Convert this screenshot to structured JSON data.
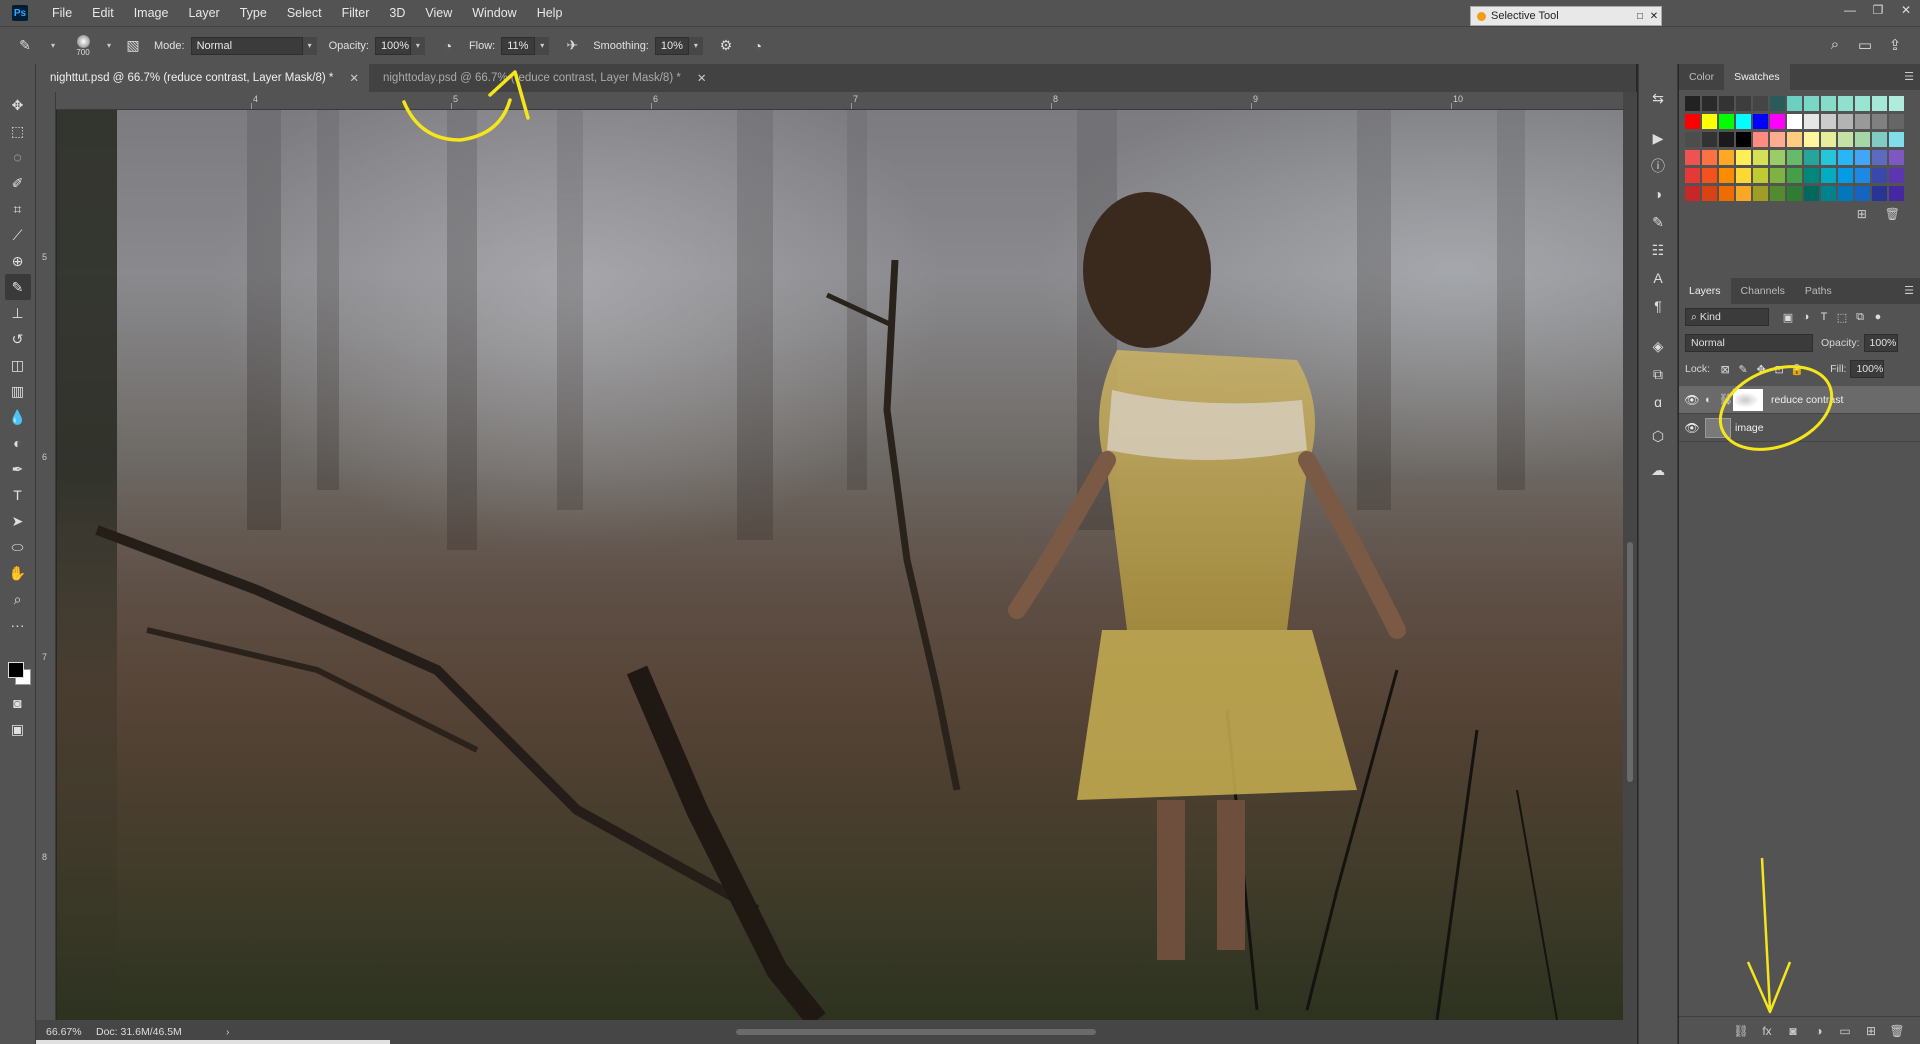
{
  "app": {
    "logo": "Ps"
  },
  "menu": [
    "File",
    "Edit",
    "Image",
    "Layer",
    "Type",
    "Select",
    "Filter",
    "3D",
    "View",
    "Window",
    "Help"
  ],
  "popup": {
    "title": "Selective Tool"
  },
  "options": {
    "brush_size": "700",
    "mode_label": "Mode:",
    "mode_value": "Normal",
    "opacity_label": "Opacity:",
    "opacity_value": "100%",
    "flow_label": "Flow:",
    "flow_value": "11%",
    "smoothing_label": "Smoothing:",
    "smoothing_value": "10%"
  },
  "tabs": [
    {
      "label": "nighttut.psd @ 66.7% (reduce contrast, Layer Mask/8) *",
      "active": true
    },
    {
      "label": "nighttoday.psd @ 66.7% (reduce contrast, Layer Mask/8) *",
      "active": false
    }
  ],
  "ruler": {
    "top": [
      "4",
      "5",
      "6",
      "7",
      "8",
      "9",
      "10"
    ],
    "left": [
      "5",
      "6",
      "7",
      "8"
    ]
  },
  "status": {
    "zoom": "66.67%",
    "doc": "Doc: 31.6M/46.5M",
    "arrow": "›"
  },
  "panels": {
    "top_tabs": [
      "Color",
      "Swatches"
    ],
    "active_top_tab": "Swatches",
    "layer_tabs": [
      "Layers",
      "Channels",
      "Paths"
    ],
    "active_layer_tab": "Layers",
    "kind_label": "Kind",
    "blend_mode": "Normal",
    "opacity_label": "Opacity:",
    "opacity_value": "100%",
    "lock_label": "Lock:",
    "fill_label": "Fill:",
    "fill_value": "100%"
  },
  "layers": [
    {
      "name": "reduce contrast",
      "active": true,
      "has_mask": true
    },
    {
      "name": "image",
      "active": false,
      "has_mask": false
    }
  ],
  "swatch_rows": [
    [
      "#222",
      "#2a2a2a",
      "#333",
      "#3d3d3d",
      "#454545",
      "#2a5a5a",
      "#6cd0c0",
      "#7ad6c6",
      "#86dccb",
      "#8fe0cf",
      "#9ae4d4",
      "#a4e8d8",
      "#b0ecdc"
    ],
    [
      "#ff0000",
      "#ffff00",
      "#00ff00",
      "#00ffff",
      "#0000ff",
      "#ff00ff",
      "#ffffff",
      "#e6e6e6",
      "#cccccc",
      "#b3b3b3",
      "#999999",
      "#808080",
      "#666666"
    ],
    [
      "#4d4d4d",
      "#333333",
      "#1a1a1a",
      "#000000",
      "#ff8a80",
      "#ffab91",
      "#ffcc80",
      "#fff59d",
      "#e6ee9c",
      "#c5e1a5",
      "#a5d6a7",
      "#80cbc4",
      "#80deea"
    ],
    [
      "#ef5350",
      "#ff7043",
      "#ffa726",
      "#ffee58",
      "#d4e157",
      "#9ccc65",
      "#66bb6a",
      "#26a69a",
      "#26c6da",
      "#29b6f6",
      "#42a5f5",
      "#5c6bc0",
      "#7e57c2"
    ],
    [
      "#e53935",
      "#f4511e",
      "#fb8c00",
      "#fdd835",
      "#c0ca33",
      "#7cb342",
      "#43a047",
      "#00897b",
      "#00acc1",
      "#039be5",
      "#1e88e5",
      "#3949ab",
      "#5e35b1"
    ],
    [
      "#c62828",
      "#d84315",
      "#ef6c00",
      "#f9a825",
      "#9e9d24",
      "#558b2f",
      "#2e7d32",
      "#00695c",
      "#00838f",
      "#0277bd",
      "#1565c0",
      "#283593",
      "#4527a0"
    ]
  ],
  "colors": {
    "annotation": "#f5e61c",
    "accent": "#31a8ff"
  }
}
